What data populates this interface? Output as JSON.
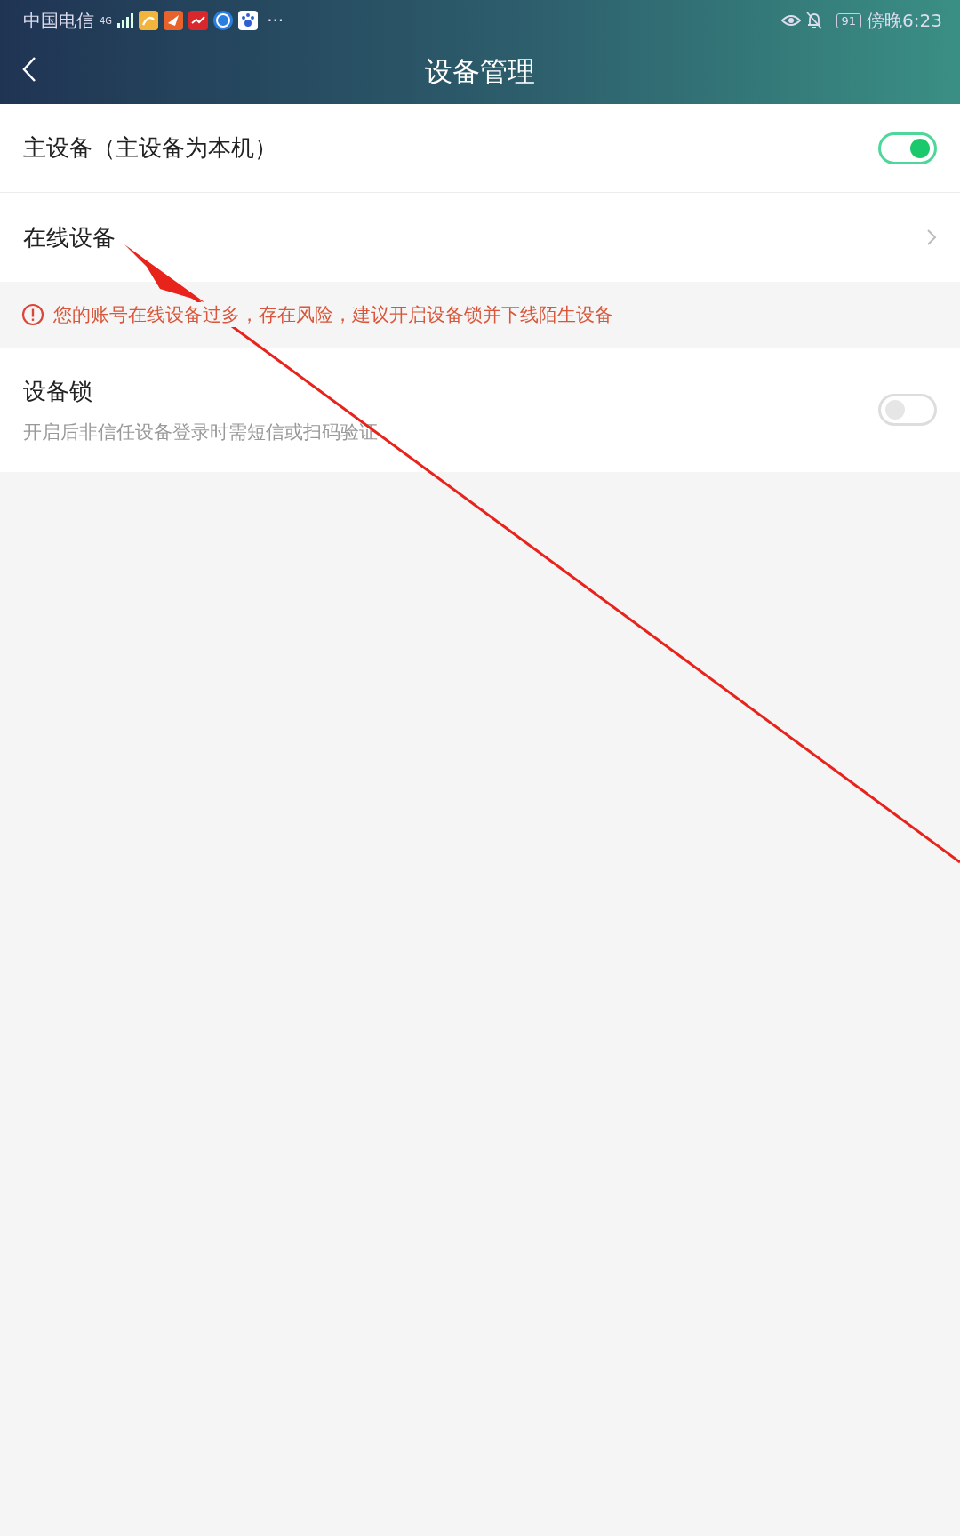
{
  "status_bar": {
    "carrier": "中国电信",
    "network": "4G",
    "more": "···",
    "battery": "91",
    "time": "傍晚6:23"
  },
  "header": {
    "title": "设备管理"
  },
  "rows": [
    {
      "kind": "toggle",
      "label": "主设备（主设备为本机）",
      "on": true
    },
    {
      "kind": "link",
      "label": "在线设备"
    }
  ],
  "warning": {
    "text": "您的账号在线设备过多，存在风险，建议开启设备锁并下线陌生设备"
  },
  "lock": {
    "kind": "toggle",
    "label": "设备锁",
    "description": "开启后非信任设备登录时需短信或扫码验证",
    "on": false
  }
}
